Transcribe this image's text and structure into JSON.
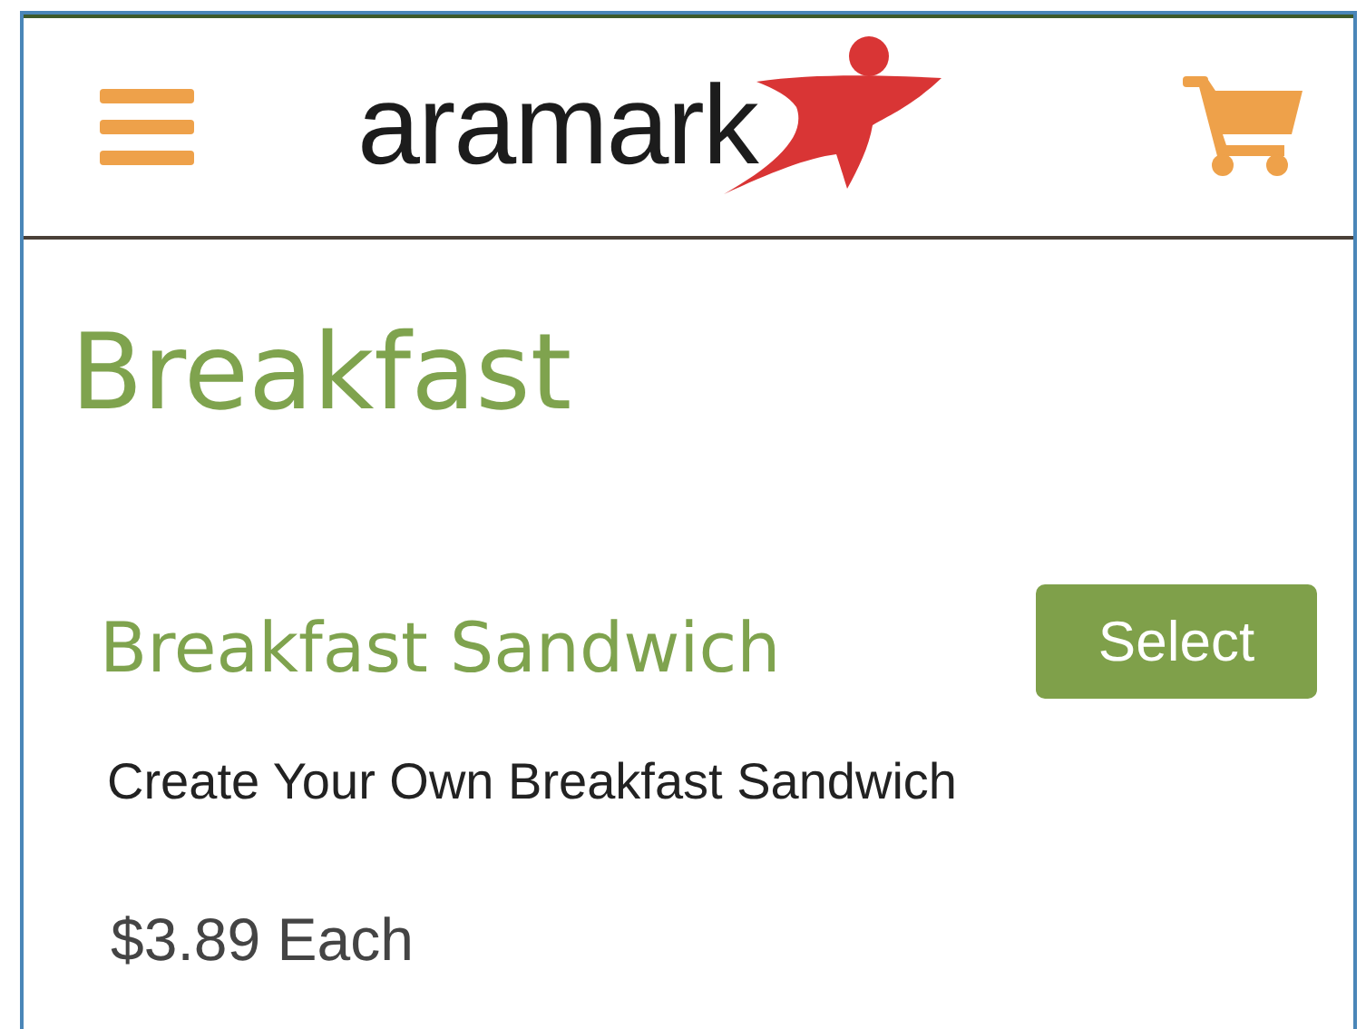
{
  "header": {
    "logo_text": "aramark"
  },
  "page_title": "Breakfast",
  "items": [
    {
      "name": "Breakfast Sandwich",
      "button": "Select",
      "description": "Create Your Own Breakfast Sandwich",
      "price": "$3.89 Each"
    }
  ]
}
